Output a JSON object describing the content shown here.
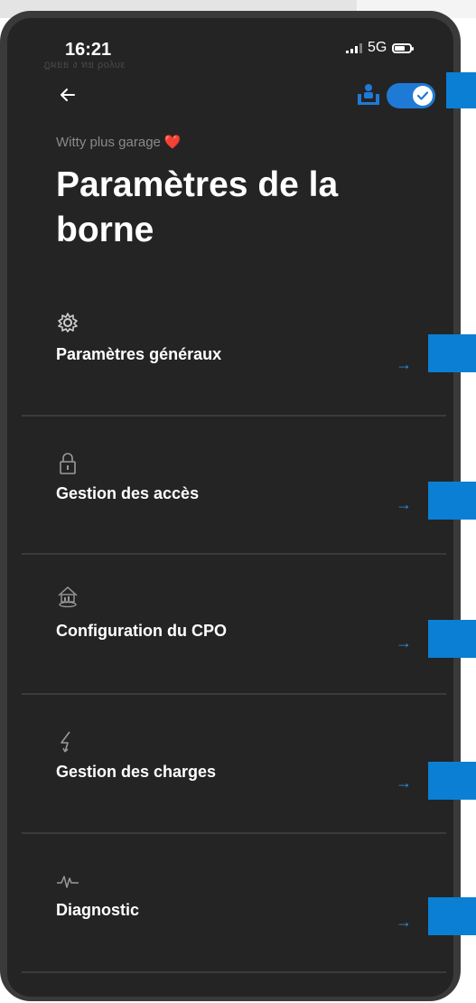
{
  "status_bar": {
    "time": "16:21",
    "network": "5G",
    "ghost_text": "ฎผยย ง ทย ρολυε"
  },
  "header": {
    "back_icon": "arrow-left-icon",
    "badge_icon": "station-person-icon",
    "toggle_state": "on"
  },
  "subtitle": {
    "text": "Witty plus garage",
    "emoji": "❤️"
  },
  "title": "Paramètres de la borne",
  "menu": [
    {
      "icon": "gear-icon",
      "label": "Paramètres généraux",
      "arrow": "→"
    },
    {
      "icon": "lock-icon",
      "label": "Gestion des accès",
      "arrow": "→"
    },
    {
      "icon": "cpo-config-icon",
      "label": "Configuration du CPO",
      "arrow": "→"
    },
    {
      "icon": "lightning-icon",
      "label": "Gestion des charges",
      "arrow": "→"
    },
    {
      "icon": "pulse-icon",
      "label": "Diagnostic",
      "arrow": "→"
    }
  ],
  "colors": {
    "background": "#242424",
    "accent": "#1f7ad6",
    "marker": "#0a7fd4",
    "arrow": "#2a8fe0"
  }
}
